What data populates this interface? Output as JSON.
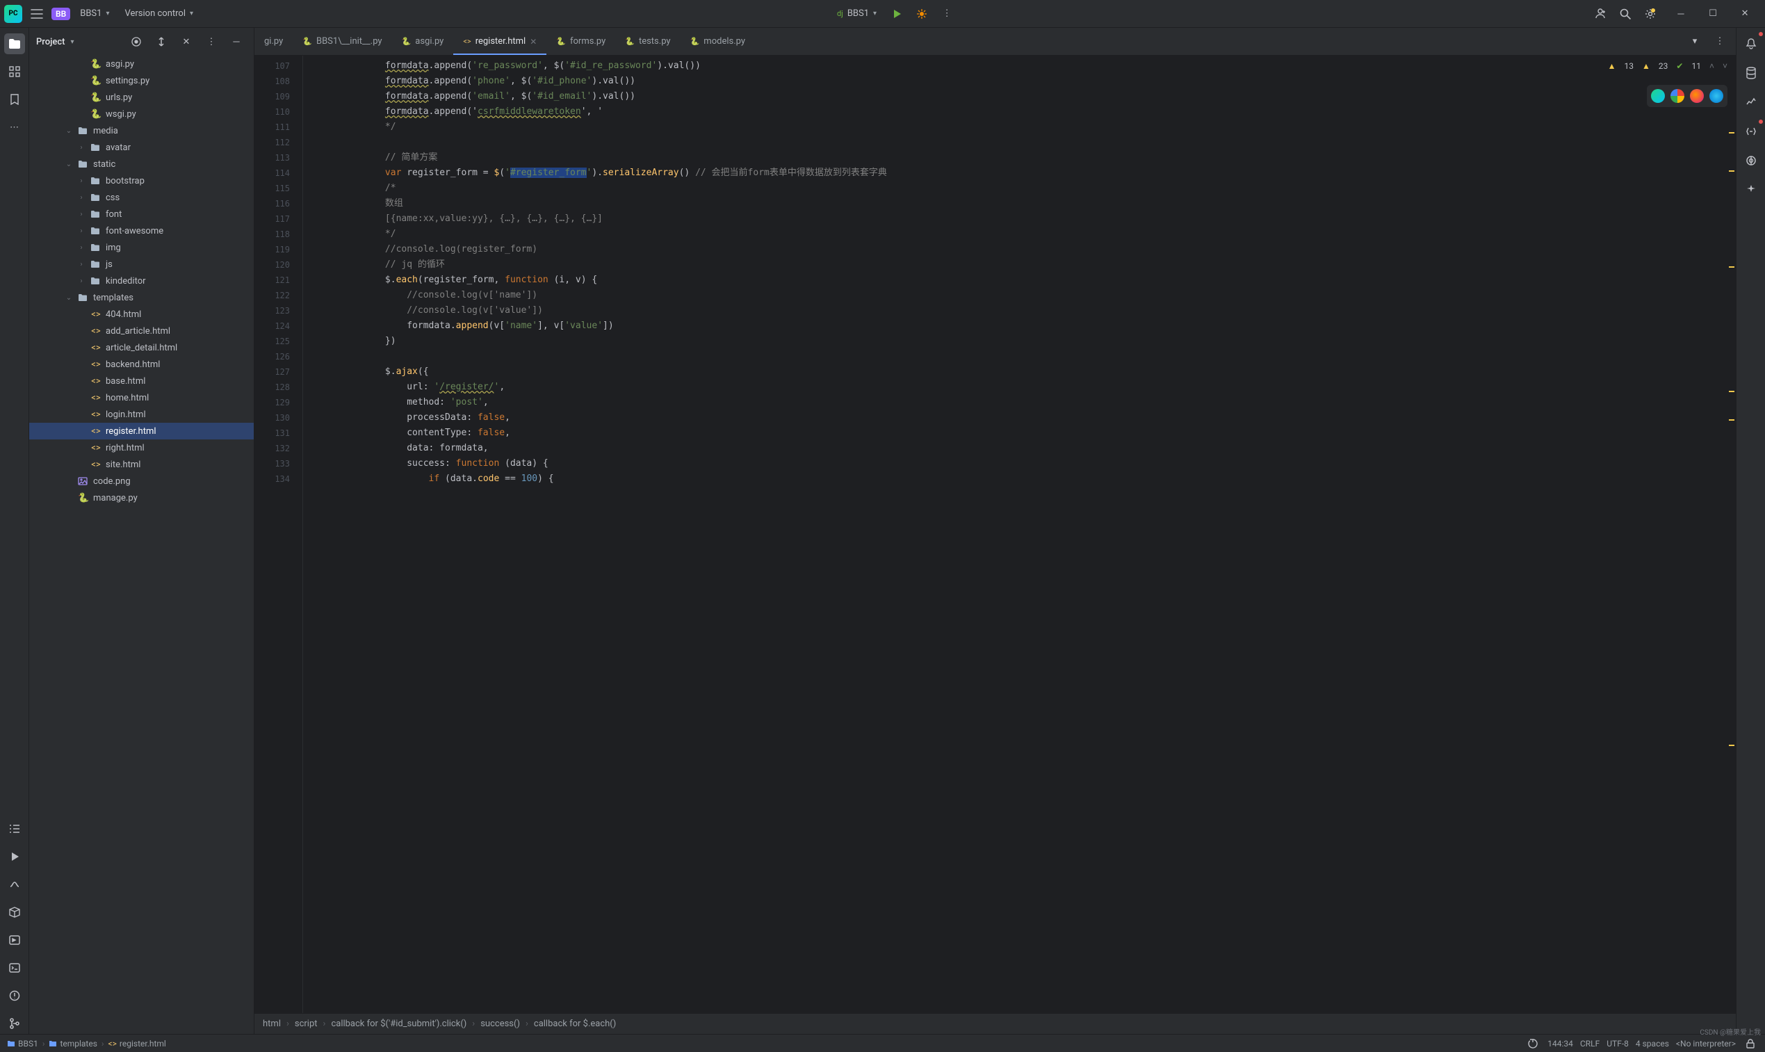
{
  "titlebar": {
    "project_badge": "BB",
    "project_name": "BBS1",
    "version_control": "Version control",
    "run_target_prefix": "dj",
    "run_target": "BBS1"
  },
  "project_panel": {
    "title": "Project"
  },
  "project_tree": [
    {
      "indent": 3,
      "kind": "py",
      "name": "asgi.py"
    },
    {
      "indent": 3,
      "kind": "py",
      "name": "settings.py"
    },
    {
      "indent": 3,
      "kind": "py",
      "name": "urls.py"
    },
    {
      "indent": 3,
      "kind": "py",
      "name": "wsgi.py"
    },
    {
      "indent": 2,
      "kind": "dir",
      "name": "media",
      "chev": "down"
    },
    {
      "indent": 3,
      "kind": "dir",
      "name": "avatar",
      "chev": "right"
    },
    {
      "indent": 2,
      "kind": "dir",
      "name": "static",
      "chev": "down"
    },
    {
      "indent": 3,
      "kind": "dir",
      "name": "bootstrap",
      "chev": "right"
    },
    {
      "indent": 3,
      "kind": "dir",
      "name": "css",
      "chev": "right"
    },
    {
      "indent": 3,
      "kind": "dir",
      "name": "font",
      "chev": "right"
    },
    {
      "indent": 3,
      "kind": "dir",
      "name": "font-awesome",
      "chev": "right"
    },
    {
      "indent": 3,
      "kind": "dir",
      "name": "img",
      "chev": "right"
    },
    {
      "indent": 3,
      "kind": "dir",
      "name": "js",
      "chev": "right"
    },
    {
      "indent": 3,
      "kind": "dir",
      "name": "kindeditor",
      "chev": "right"
    },
    {
      "indent": 2,
      "kind": "dir",
      "name": "templates",
      "chev": "down"
    },
    {
      "indent": 3,
      "kind": "html",
      "name": "404.html"
    },
    {
      "indent": 3,
      "kind": "html",
      "name": "add_article.html"
    },
    {
      "indent": 3,
      "kind": "html",
      "name": "article_detail.html"
    },
    {
      "indent": 3,
      "kind": "html",
      "name": "backend.html"
    },
    {
      "indent": 3,
      "kind": "html",
      "name": "base.html"
    },
    {
      "indent": 3,
      "kind": "html",
      "name": "home.html"
    },
    {
      "indent": 3,
      "kind": "html",
      "name": "login.html"
    },
    {
      "indent": 3,
      "kind": "html",
      "name": "register.html",
      "selected": true
    },
    {
      "indent": 3,
      "kind": "html",
      "name": "right.html"
    },
    {
      "indent": 3,
      "kind": "html",
      "name": "site.html"
    },
    {
      "indent": 2,
      "kind": "img",
      "name": "code.png"
    },
    {
      "indent": 2,
      "kind": "py",
      "name": "manage.py"
    }
  ],
  "tabs": [
    {
      "label": "gi.py",
      "icon": "none",
      "truncated": true
    },
    {
      "label": "BBS1\\__init__.py",
      "icon": "py"
    },
    {
      "label": "asgi.py",
      "icon": "py"
    },
    {
      "label": "register.html",
      "icon": "html",
      "active": true,
      "close": true
    },
    {
      "label": "forms.py",
      "icon": "py"
    },
    {
      "label": "tests.py",
      "icon": "py"
    },
    {
      "label": "models.py",
      "icon": "py"
    }
  ],
  "inspections": {
    "warn1": "13",
    "warn2": "23",
    "check": "11"
  },
  "gutter_start": 107,
  "gutter_end": 134,
  "code_lines": [
    {
      "indent": 3,
      "segments": [
        {
          "t": "formdata",
          "cls": "squiggle"
        },
        {
          "t": ".append("
        },
        {
          "t": "'re_password'",
          "cls": "s"
        },
        {
          "t": ", $("
        },
        {
          "t": "'#id_re_password'",
          "cls": "s"
        },
        {
          "t": ").val())"
        }
      ]
    },
    {
      "indent": 3,
      "segments": [
        {
          "t": "formdata",
          "cls": "squiggle"
        },
        {
          "t": ".append("
        },
        {
          "t": "'phone'",
          "cls": "s"
        },
        {
          "t": ", $("
        },
        {
          "t": "'#id_phone'",
          "cls": "s"
        },
        {
          "t": ").val())"
        }
      ]
    },
    {
      "indent": 3,
      "segments": [
        {
          "t": "formdata",
          "cls": "squiggle"
        },
        {
          "t": ".append("
        },
        {
          "t": "'email'",
          "cls": "s"
        },
        {
          "t": ", $("
        },
        {
          "t": "'#id_email'",
          "cls": "s"
        },
        {
          "t": ").val())"
        }
      ]
    },
    {
      "indent": 3,
      "segments": [
        {
          "t": "formdata",
          "cls": "squiggle"
        },
        {
          "t": ".append("
        },
        {
          "t": "'"
        },
        {
          "t": "csrfmiddlewaretoken",
          "cls": "squiggle s"
        },
        {
          "t": "'"
        },
        {
          "t": ", '"
        }
      ]
    },
    {
      "indent": 3,
      "segments": [
        {
          "t": "*/",
          "cls": "c"
        }
      ]
    },
    {
      "indent": 0,
      "segments": []
    },
    {
      "indent": 3,
      "segments": [
        {
          "t": "// 简单方案",
          "cls": "c"
        }
      ]
    },
    {
      "indent": 3,
      "segments": [
        {
          "t": "var",
          "cls": "k"
        },
        {
          "t": " register_form = "
        },
        {
          "t": "$",
          "cls": "fn"
        },
        {
          "t": "("
        },
        {
          "t": "'",
          "cls": "s"
        },
        {
          "t": "#register_form",
          "cls": "s hl"
        },
        {
          "t": "'",
          "cls": "s"
        },
        {
          "t": ")."
        },
        {
          "t": "serializeArray",
          "cls": "fn"
        },
        {
          "t": "() "
        },
        {
          "t": "// 会把当前form表单中得数据放到列表套字典",
          "cls": "c"
        }
      ]
    },
    {
      "indent": 3,
      "segments": [
        {
          "t": "/*",
          "cls": "c"
        }
      ]
    },
    {
      "indent": 3,
      "segments": [
        {
          "t": "数组",
          "cls": "c"
        }
      ]
    },
    {
      "indent": 3,
      "segments": [
        {
          "t": "[{name:xx,value:yy}, {…}, {…}, {…}, {…}]",
          "cls": "c"
        }
      ]
    },
    {
      "indent": 3,
      "segments": [
        {
          "t": "*/",
          "cls": "c"
        }
      ]
    },
    {
      "indent": 3,
      "segments": [
        {
          "t": "//console.log(register_form)",
          "cls": "c"
        }
      ]
    },
    {
      "indent": 3,
      "segments": [
        {
          "t": "// jq 的循环",
          "cls": "c"
        }
      ]
    },
    {
      "indent": 3,
      "segments": [
        {
          "t": "$."
        },
        {
          "t": "each",
          "cls": "fn"
        },
        {
          "t": "(register_form, "
        },
        {
          "t": "function",
          "cls": "k"
        },
        {
          "t": " (i, v) {"
        }
      ]
    },
    {
      "indent": 4,
      "segments": [
        {
          "t": "//console.log(v['name'])",
          "cls": "c"
        }
      ]
    },
    {
      "indent": 4,
      "segments": [
        {
          "t": "//console.log(v['value'])",
          "cls": "c"
        }
      ]
    },
    {
      "indent": 4,
      "segments": [
        {
          "t": "formdata."
        },
        {
          "t": "append",
          "cls": "fn"
        },
        {
          "t": "(v["
        },
        {
          "t": "'name'",
          "cls": "s"
        },
        {
          "t": "], v["
        },
        {
          "t": "'value'",
          "cls": "s"
        },
        {
          "t": "])"
        }
      ]
    },
    {
      "indent": 3,
      "segments": [
        {
          "t": "})"
        }
      ]
    },
    {
      "indent": 0,
      "segments": []
    },
    {
      "indent": 3,
      "segments": [
        {
          "t": "$."
        },
        {
          "t": "ajax",
          "cls": "fn"
        },
        {
          "t": "({"
        }
      ]
    },
    {
      "indent": 4,
      "segments": [
        {
          "t": "url: "
        },
        {
          "t": "'",
          "cls": "s"
        },
        {
          "t": "/register/",
          "cls": "s squiggle"
        },
        {
          "t": "'",
          "cls": "s"
        },
        {
          "t": ","
        }
      ]
    },
    {
      "indent": 4,
      "segments": [
        {
          "t": "method: "
        },
        {
          "t": "'post'",
          "cls": "s"
        },
        {
          "t": ","
        }
      ]
    },
    {
      "indent": 4,
      "segments": [
        {
          "t": "processData: "
        },
        {
          "t": "false",
          "cls": "k"
        },
        {
          "t": ","
        }
      ]
    },
    {
      "indent": 4,
      "segments": [
        {
          "t": "contentType: "
        },
        {
          "t": "false",
          "cls": "k"
        },
        {
          "t": ","
        }
      ]
    },
    {
      "indent": 4,
      "segments": [
        {
          "t": "data: formdata,"
        }
      ]
    },
    {
      "indent": 4,
      "segments": [
        {
          "t": "success: "
        },
        {
          "t": "function",
          "cls": "k"
        },
        {
          "t": " (data) {"
        }
      ]
    },
    {
      "indent": 5,
      "segments": [
        {
          "t": "if",
          "cls": "k"
        },
        {
          "t": " (data."
        },
        {
          "t": "code",
          "cls": "fn"
        },
        {
          "t": " == "
        },
        {
          "t": "100",
          "cls": "n"
        },
        {
          "t": ") {"
        }
      ]
    }
  ],
  "breadcrumbs": [
    "html",
    "script",
    "callback for $('#id_submit').click()",
    "success()",
    "callback for $.each()"
  ],
  "status_crumbs": [
    "BBS1",
    "templates",
    "register.html"
  ],
  "status_right": {
    "position": "144:34",
    "line_sep": "CRLF",
    "encoding": "UTF-8",
    "indent": "4 spaces",
    "interpreter": "<No interpreter>"
  },
  "watermark": "CSDN @糖果爱上我"
}
